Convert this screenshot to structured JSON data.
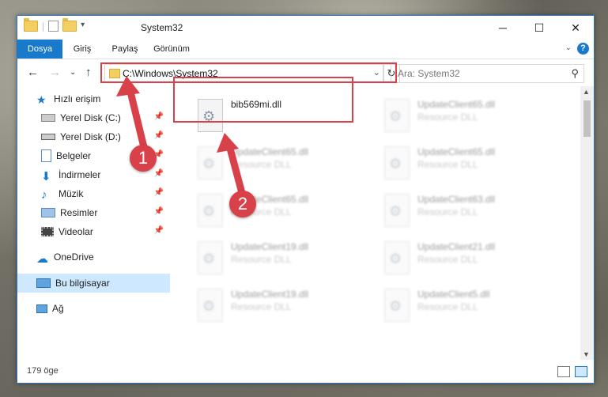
{
  "window": {
    "title": "System32"
  },
  "ribbon": {
    "tabs": [
      "Dosya",
      "Giriş",
      "Paylaş",
      "Görünüm"
    ],
    "help": "?"
  },
  "nav": {
    "address": "C:\\Windows\\System32",
    "search_placeholder": "Ara: System32"
  },
  "sidebar": {
    "items": [
      {
        "label": "Hızlı erişim",
        "icon": "star-icon"
      },
      {
        "label": "Yerel Disk (C:)",
        "icon": "drive-icon"
      },
      {
        "label": "Yerel Disk (D:)",
        "icon": "drive-icon"
      },
      {
        "label": "Belgeler",
        "icon": "documents-icon"
      },
      {
        "label": "İndirmeler",
        "icon": "download-icon"
      },
      {
        "label": "Müzik",
        "icon": "music-icon"
      },
      {
        "label": "Resimler",
        "icon": "pictures-icon"
      },
      {
        "label": "Videolar",
        "icon": "video-icon"
      },
      {
        "label": "OneDrive",
        "icon": "cloud-icon"
      },
      {
        "label": "Bu bilgisayar",
        "icon": "computer-icon"
      },
      {
        "label": "Ağ",
        "icon": "network-icon"
      }
    ]
  },
  "files": [
    {
      "name": "bib569mi.dll",
      "type": ""
    },
    {
      "name": "UpdateClient65.dll",
      "type": "Resource DLL"
    },
    {
      "name": "UpdateClient65.dll",
      "type": "Resource DLL"
    },
    {
      "name": "UpdateClient65.dll",
      "type": "Resource DLL"
    },
    {
      "name": "UpdateClient65.dll",
      "type": "Resource DLL"
    },
    {
      "name": "UpdateClient63.dll",
      "type": "Resource DLL"
    },
    {
      "name": "UpdateClient19.dll",
      "type": "Resource DLL"
    },
    {
      "name": "UpdateClient21.dll",
      "type": "Resource DLL"
    },
    {
      "name": "UpdateClient19.dll",
      "type": "Resource DLL"
    },
    {
      "name": "UpdateClient5.dll",
      "type": "Resource DLL"
    }
  ],
  "status": {
    "count": "179 öge"
  },
  "annotations": {
    "badge1": "1",
    "badge2": "2",
    "color": "#d8414a"
  },
  "colors": {
    "accent": "#1979ca",
    "selection": "#cde8ff"
  }
}
